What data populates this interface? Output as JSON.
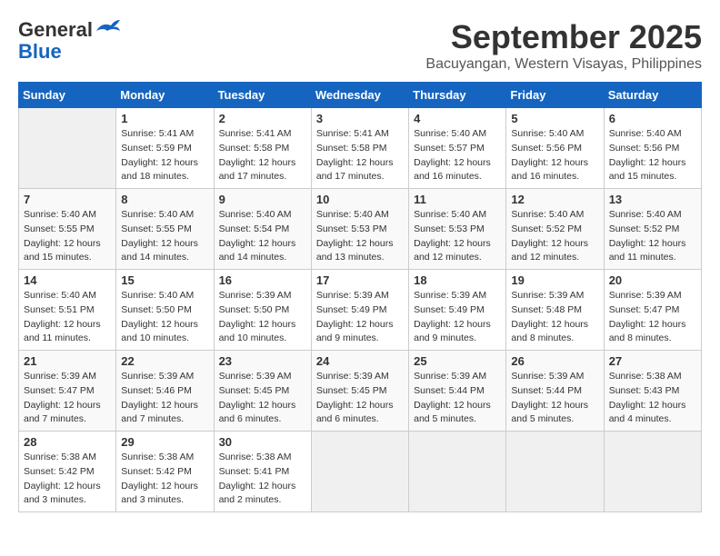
{
  "header": {
    "logo_general": "General",
    "logo_blue": "Blue",
    "month": "September 2025",
    "location": "Bacuyangan, Western Visayas, Philippines"
  },
  "days_of_week": [
    "Sunday",
    "Monday",
    "Tuesday",
    "Wednesday",
    "Thursday",
    "Friday",
    "Saturday"
  ],
  "weeks": [
    [
      {
        "day": "",
        "sunrise": "",
        "sunset": "",
        "daylight": ""
      },
      {
        "day": "1",
        "sunrise": "Sunrise: 5:41 AM",
        "sunset": "Sunset: 5:59 PM",
        "daylight": "Daylight: 12 hours and 18 minutes."
      },
      {
        "day": "2",
        "sunrise": "Sunrise: 5:41 AM",
        "sunset": "Sunset: 5:58 PM",
        "daylight": "Daylight: 12 hours and 17 minutes."
      },
      {
        "day": "3",
        "sunrise": "Sunrise: 5:41 AM",
        "sunset": "Sunset: 5:58 PM",
        "daylight": "Daylight: 12 hours and 17 minutes."
      },
      {
        "day": "4",
        "sunrise": "Sunrise: 5:40 AM",
        "sunset": "Sunset: 5:57 PM",
        "daylight": "Daylight: 12 hours and 16 minutes."
      },
      {
        "day": "5",
        "sunrise": "Sunrise: 5:40 AM",
        "sunset": "Sunset: 5:56 PM",
        "daylight": "Daylight: 12 hours and 16 minutes."
      },
      {
        "day": "6",
        "sunrise": "Sunrise: 5:40 AM",
        "sunset": "Sunset: 5:56 PM",
        "daylight": "Daylight: 12 hours and 15 minutes."
      }
    ],
    [
      {
        "day": "7",
        "sunrise": "Sunrise: 5:40 AM",
        "sunset": "Sunset: 5:55 PM",
        "daylight": "Daylight: 12 hours and 15 minutes."
      },
      {
        "day": "8",
        "sunrise": "Sunrise: 5:40 AM",
        "sunset": "Sunset: 5:55 PM",
        "daylight": "Daylight: 12 hours and 14 minutes."
      },
      {
        "day": "9",
        "sunrise": "Sunrise: 5:40 AM",
        "sunset": "Sunset: 5:54 PM",
        "daylight": "Daylight: 12 hours and 14 minutes."
      },
      {
        "day": "10",
        "sunrise": "Sunrise: 5:40 AM",
        "sunset": "Sunset: 5:53 PM",
        "daylight": "Daylight: 12 hours and 13 minutes."
      },
      {
        "day": "11",
        "sunrise": "Sunrise: 5:40 AM",
        "sunset": "Sunset: 5:53 PM",
        "daylight": "Daylight: 12 hours and 12 minutes."
      },
      {
        "day": "12",
        "sunrise": "Sunrise: 5:40 AM",
        "sunset": "Sunset: 5:52 PM",
        "daylight": "Daylight: 12 hours and 12 minutes."
      },
      {
        "day": "13",
        "sunrise": "Sunrise: 5:40 AM",
        "sunset": "Sunset: 5:52 PM",
        "daylight": "Daylight: 12 hours and 11 minutes."
      }
    ],
    [
      {
        "day": "14",
        "sunrise": "Sunrise: 5:40 AM",
        "sunset": "Sunset: 5:51 PM",
        "daylight": "Daylight: 12 hours and 11 minutes."
      },
      {
        "day": "15",
        "sunrise": "Sunrise: 5:40 AM",
        "sunset": "Sunset: 5:50 PM",
        "daylight": "Daylight: 12 hours and 10 minutes."
      },
      {
        "day": "16",
        "sunrise": "Sunrise: 5:39 AM",
        "sunset": "Sunset: 5:50 PM",
        "daylight": "Daylight: 12 hours and 10 minutes."
      },
      {
        "day": "17",
        "sunrise": "Sunrise: 5:39 AM",
        "sunset": "Sunset: 5:49 PM",
        "daylight": "Daylight: 12 hours and 9 minutes."
      },
      {
        "day": "18",
        "sunrise": "Sunrise: 5:39 AM",
        "sunset": "Sunset: 5:49 PM",
        "daylight": "Daylight: 12 hours and 9 minutes."
      },
      {
        "day": "19",
        "sunrise": "Sunrise: 5:39 AM",
        "sunset": "Sunset: 5:48 PM",
        "daylight": "Daylight: 12 hours and 8 minutes."
      },
      {
        "day": "20",
        "sunrise": "Sunrise: 5:39 AM",
        "sunset": "Sunset: 5:47 PM",
        "daylight": "Daylight: 12 hours and 8 minutes."
      }
    ],
    [
      {
        "day": "21",
        "sunrise": "Sunrise: 5:39 AM",
        "sunset": "Sunset: 5:47 PM",
        "daylight": "Daylight: 12 hours and 7 minutes."
      },
      {
        "day": "22",
        "sunrise": "Sunrise: 5:39 AM",
        "sunset": "Sunset: 5:46 PM",
        "daylight": "Daylight: 12 hours and 7 minutes."
      },
      {
        "day": "23",
        "sunrise": "Sunrise: 5:39 AM",
        "sunset": "Sunset: 5:45 PM",
        "daylight": "Daylight: 12 hours and 6 minutes."
      },
      {
        "day": "24",
        "sunrise": "Sunrise: 5:39 AM",
        "sunset": "Sunset: 5:45 PM",
        "daylight": "Daylight: 12 hours and 6 minutes."
      },
      {
        "day": "25",
        "sunrise": "Sunrise: 5:39 AM",
        "sunset": "Sunset: 5:44 PM",
        "daylight": "Daylight: 12 hours and 5 minutes."
      },
      {
        "day": "26",
        "sunrise": "Sunrise: 5:39 AM",
        "sunset": "Sunset: 5:44 PM",
        "daylight": "Daylight: 12 hours and 5 minutes."
      },
      {
        "day": "27",
        "sunrise": "Sunrise: 5:38 AM",
        "sunset": "Sunset: 5:43 PM",
        "daylight": "Daylight: 12 hours and 4 minutes."
      }
    ],
    [
      {
        "day": "28",
        "sunrise": "Sunrise: 5:38 AM",
        "sunset": "Sunset: 5:42 PM",
        "daylight": "Daylight: 12 hours and 3 minutes."
      },
      {
        "day": "29",
        "sunrise": "Sunrise: 5:38 AM",
        "sunset": "Sunset: 5:42 PM",
        "daylight": "Daylight: 12 hours and 3 minutes."
      },
      {
        "day": "30",
        "sunrise": "Sunrise: 5:38 AM",
        "sunset": "Sunset: 5:41 PM",
        "daylight": "Daylight: 12 hours and 2 minutes."
      },
      {
        "day": "",
        "sunrise": "",
        "sunset": "",
        "daylight": ""
      },
      {
        "day": "",
        "sunrise": "",
        "sunset": "",
        "daylight": ""
      },
      {
        "day": "",
        "sunrise": "",
        "sunset": "",
        "daylight": ""
      },
      {
        "day": "",
        "sunrise": "",
        "sunset": "",
        "daylight": ""
      }
    ]
  ]
}
